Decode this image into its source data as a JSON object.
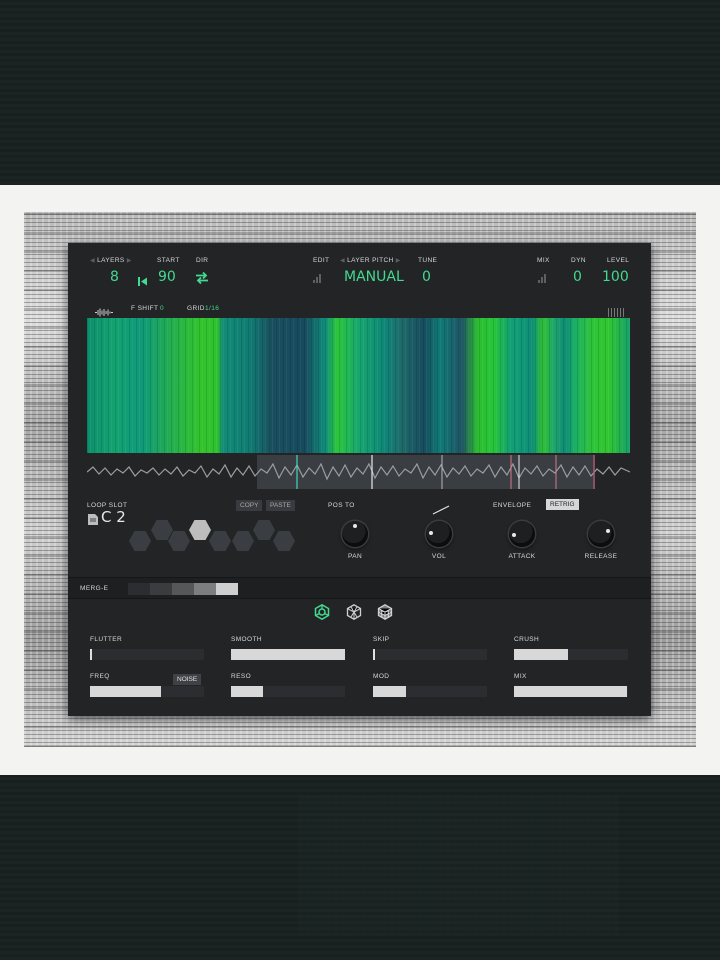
{
  "header": {
    "layers": {
      "label": "LAYERS",
      "value": "8"
    },
    "start": {
      "label": "START",
      "value": "90"
    },
    "dir": {
      "label": "DIR"
    },
    "edit": {
      "label": "EDIT"
    },
    "layer_pitch": {
      "label": "LAYER PITCH",
      "value": "MANUAL"
    },
    "tune": {
      "label": "TUNE",
      "value": "0"
    },
    "mix": {
      "label": "MIX"
    },
    "dyn": {
      "label": "DYN",
      "value": "0"
    },
    "level": {
      "label": "LEVEL",
      "value": "100"
    }
  },
  "waveform_header": {
    "f_shift_label": "F SHIFT",
    "f_shift_value": "0",
    "grid_label": "GRID",
    "grid_value": "1/16"
  },
  "loop": {
    "slot_label": "LOOP SLOT",
    "slot_value": "C 2",
    "copy_label": "COPY",
    "paste_label": "PASTE"
  },
  "pos_to_label": "POS TO",
  "envelope_label": "ENVELOPE",
  "retrig_label": "RETRIG",
  "knobs": [
    {
      "name": "pan-knob",
      "label": "PAN",
      "value": 0.5
    },
    {
      "name": "vol-knob",
      "label": "VOL",
      "value": 0.2
    },
    {
      "name": "attack-knob",
      "label": "ATTACK",
      "value": 0.15
    },
    {
      "name": "release-knob",
      "label": "RELEASE",
      "value": 0.75
    }
  ],
  "merge": {
    "label": "MERG-E"
  },
  "effects": {
    "flutter": {
      "label": "FLUTTER",
      "value": 0.0
    },
    "smooth": {
      "label": "SMOOTH",
      "value": 1.0
    },
    "skip": {
      "label": "SKIP",
      "value": 0.0
    },
    "crush": {
      "label": "CRUSH",
      "value": 0.47
    },
    "freq": {
      "label": "FREQ",
      "value": 0.62
    },
    "noise_label": "NOISE",
    "reso": {
      "label": "RESO",
      "value": 0.28
    },
    "mod": {
      "label": "MOD",
      "value": 0.29
    },
    "mix": {
      "label": "MIX",
      "value": 0.99
    }
  },
  "colors": {
    "accent": "#43d98f",
    "panel": "#222426",
    "retrig_bg": "#d7d7d7"
  },
  "icons": [
    "waveform-icon",
    "ladder-icon",
    "skip-back-icon",
    "swap-arrows-icon",
    "file-icon",
    "mode-ring-icon",
    "mode-cube-icon",
    "mode-cube-grid-icon"
  ]
}
